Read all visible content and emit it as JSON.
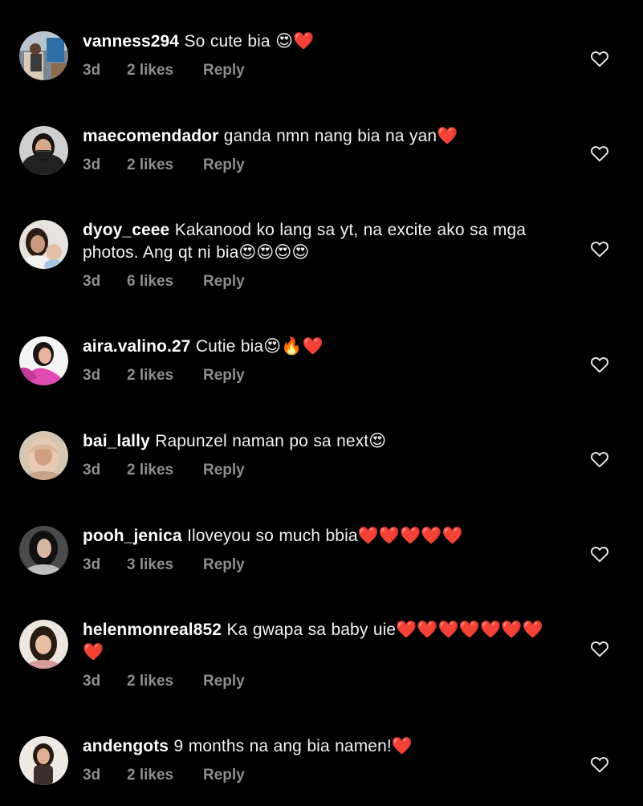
{
  "colors": {
    "background": "#000000",
    "text": "#f2f2f2",
    "muted": "#8e8e8e",
    "heart_red": "#f0243a"
  },
  "comments": [
    {
      "username": "vanness294",
      "text": "So cute bia 😍❤️",
      "time": "3d",
      "likes": "2 likes",
      "reply": "Reply",
      "avatar_icon": "avatar-photo",
      "like_icon": "heart-outline-icon"
    },
    {
      "username": "maecomendador",
      "text": "ganda nmn nang bia na yan❤️",
      "time": "3d",
      "likes": "2 likes",
      "reply": "Reply",
      "avatar_icon": "avatar-photo",
      "like_icon": "heart-outline-icon"
    },
    {
      "username": "dyoy_ceee",
      "text": "Kakanood ko lang sa yt, na excite ako sa mga photos. Ang qt ni bia😍😍😍😍",
      "time": "3d",
      "likes": "6 likes",
      "reply": "Reply",
      "avatar_icon": "avatar-photo",
      "like_icon": "heart-outline-icon"
    },
    {
      "username": "aira.valino.27",
      "text": "Cutie bia😍🔥❤️",
      "time": "3d",
      "likes": "2 likes",
      "reply": "Reply",
      "avatar_icon": "avatar-photo",
      "like_icon": "heart-outline-icon"
    },
    {
      "username": "bai_lally",
      "text": "Rapunzel naman po sa next😍",
      "time": "3d",
      "likes": "2 likes",
      "reply": "Reply",
      "avatar_icon": "avatar-photo",
      "like_icon": "heart-outline-icon"
    },
    {
      "username": "pooh_jenica",
      "text": "Iloveyou so much bbia❤️❤️❤️❤️❤️",
      "time": "3d",
      "likes": "3 likes",
      "reply": "Reply",
      "avatar_icon": "avatar-photo",
      "like_icon": "heart-outline-icon"
    },
    {
      "username": "helenmonreal852",
      "text": "Ka gwapa sa baby uie❤️❤️❤️❤️❤️❤️❤️❤️",
      "time": "3d",
      "likes": "2 likes",
      "reply": "Reply",
      "avatar_icon": "avatar-photo",
      "like_icon": "heart-outline-icon"
    },
    {
      "username": "andengots",
      "text": "9 months na ang bia namen!❤️",
      "time": "3d",
      "likes": "2 likes",
      "reply": "Reply",
      "avatar_icon": "avatar-photo",
      "like_icon": "heart-outline-icon"
    }
  ]
}
